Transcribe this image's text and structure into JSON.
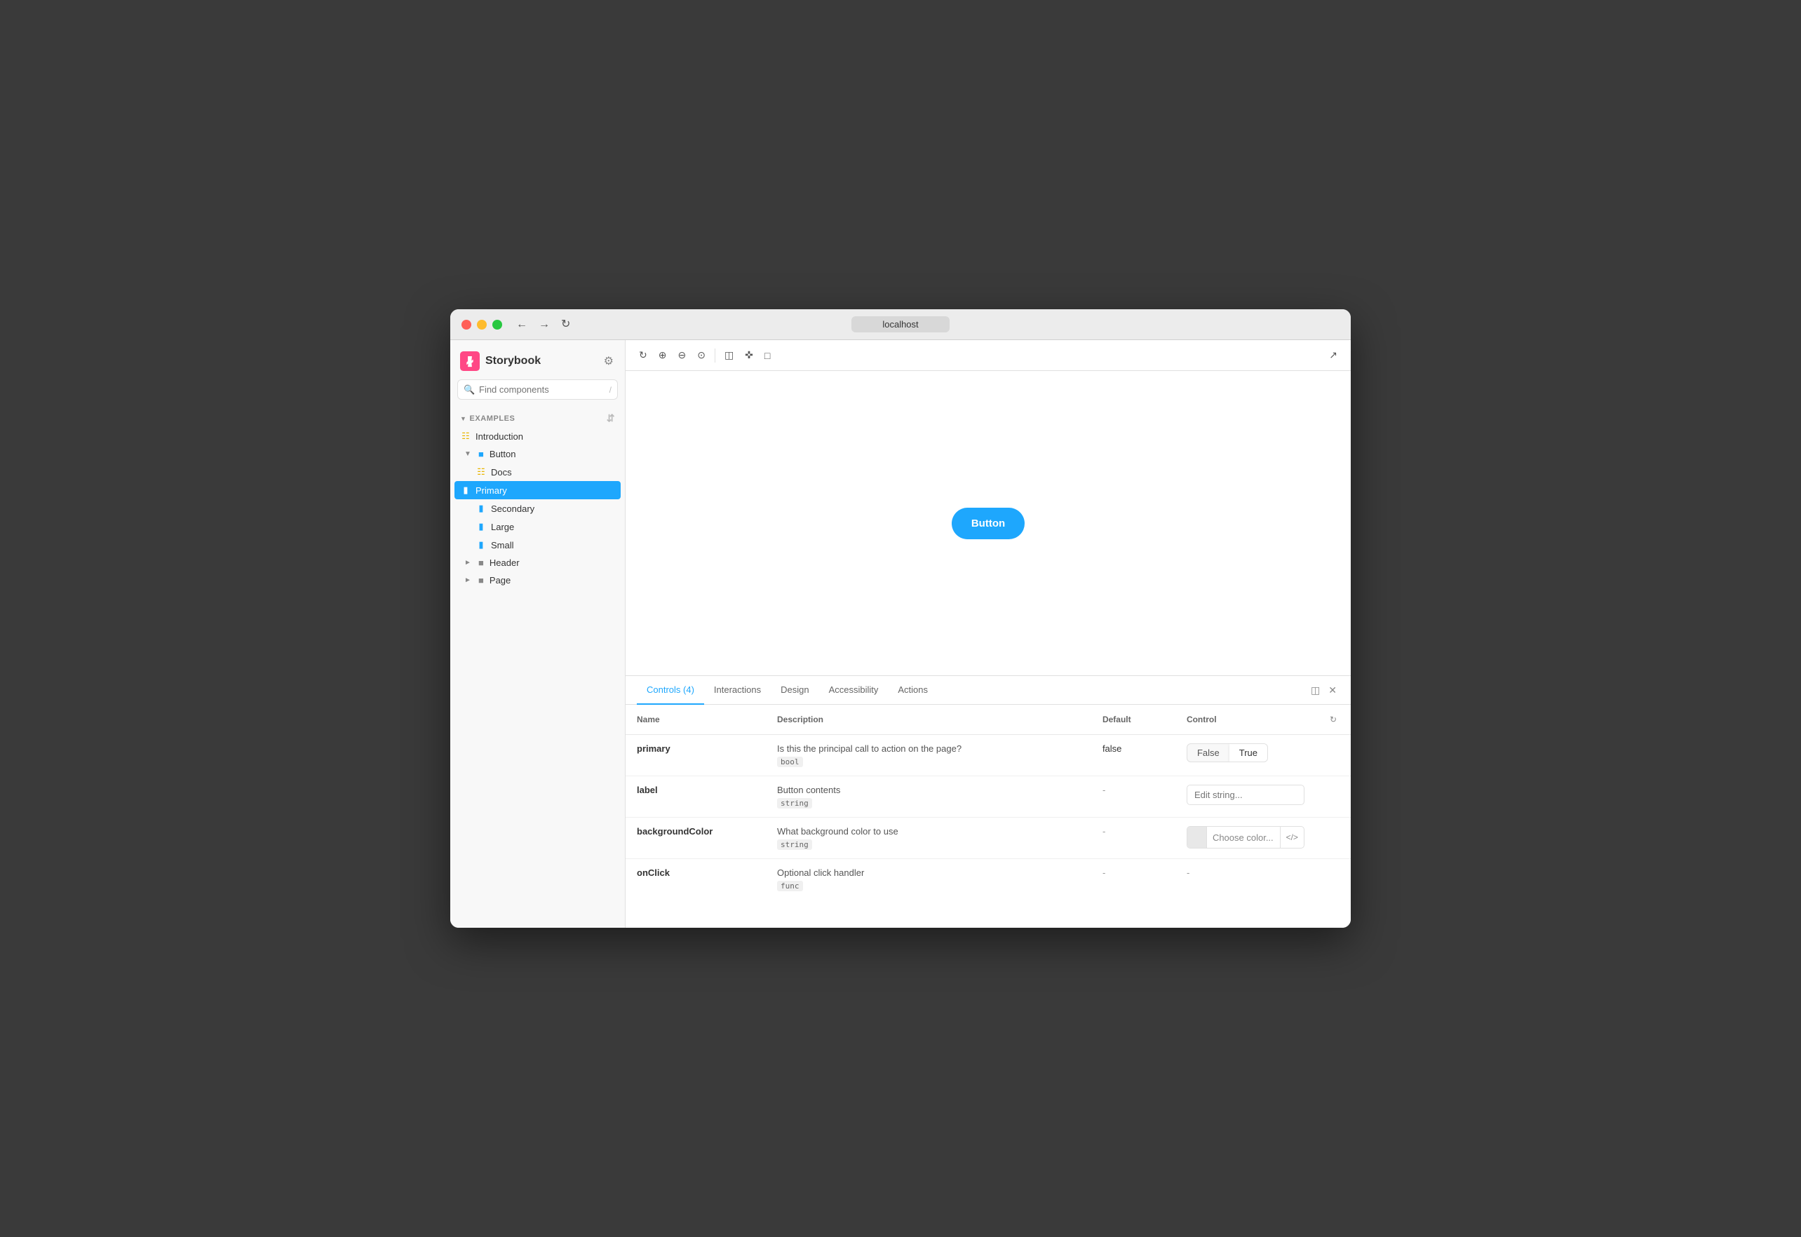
{
  "window": {
    "title": "localhost",
    "traffic_lights": [
      "close",
      "minimize",
      "maximize"
    ]
  },
  "sidebar": {
    "logo_text": "Storybook",
    "search_placeholder": "Find components",
    "search_shortcut": "/",
    "section_label": "EXAMPLES",
    "nav_items": [
      {
        "id": "introduction",
        "label": "Introduction",
        "icon": "docs",
        "depth": 0
      },
      {
        "id": "button",
        "label": "Button",
        "icon": "component",
        "depth": 0,
        "expanded": true
      },
      {
        "id": "button-docs",
        "label": "Docs",
        "icon": "docs",
        "depth": 1
      },
      {
        "id": "button-primary",
        "label": "Primary",
        "icon": "story",
        "depth": 1,
        "active": true
      },
      {
        "id": "button-secondary",
        "label": "Secondary",
        "icon": "story",
        "depth": 1
      },
      {
        "id": "button-large",
        "label": "Large",
        "icon": "story",
        "depth": 1
      },
      {
        "id": "button-small",
        "label": "Small",
        "icon": "story",
        "depth": 1
      },
      {
        "id": "header",
        "label": "Header",
        "icon": "component",
        "depth": 0
      },
      {
        "id": "page",
        "label": "Page",
        "icon": "component",
        "depth": 0
      }
    ]
  },
  "toolbar": {
    "buttons": [
      {
        "id": "reload",
        "symbol": "↺",
        "label": "Reload"
      },
      {
        "id": "zoom-in",
        "symbol": "⊕",
        "label": "Zoom in"
      },
      {
        "id": "zoom-out",
        "symbol": "⊖",
        "label": "Zoom out"
      },
      {
        "id": "zoom-reset",
        "symbol": "⊙",
        "label": "Reset zoom"
      },
      {
        "id": "frame",
        "symbol": "▣",
        "label": "Frame"
      },
      {
        "id": "grid",
        "symbol": "⊞",
        "label": "Grid"
      },
      {
        "id": "measure",
        "symbol": "⊡",
        "label": "Measure"
      },
      {
        "id": "external",
        "symbol": "↗",
        "label": "Open in new tab"
      }
    ]
  },
  "preview": {
    "button_label": "Button"
  },
  "bottom_panel": {
    "tabs": [
      {
        "id": "controls",
        "label": "Controls (4)",
        "active": true
      },
      {
        "id": "interactions",
        "label": "Interactions"
      },
      {
        "id": "design",
        "label": "Design"
      },
      {
        "id": "accessibility",
        "label": "Accessibility"
      },
      {
        "id": "actions",
        "label": "Actions"
      }
    ],
    "table": {
      "headers": {
        "name": "Name",
        "description": "Description",
        "default": "Default",
        "control": "Control"
      },
      "rows": [
        {
          "name": "primary",
          "description": "Is this the principal call to action on the page?",
          "type": "bool",
          "default": "false",
          "control_type": "bool-toggle",
          "false_label": "False",
          "true_label": "True",
          "true_active": true
        },
        {
          "name": "label",
          "description": "Button contents",
          "type": "string",
          "default": "-",
          "control_type": "string-input",
          "placeholder": "Edit string..."
        },
        {
          "name": "backgroundColor",
          "description": "What background color to use",
          "type": "string",
          "default": "-",
          "control_type": "color-picker",
          "color_placeholder": "Choose color..."
        },
        {
          "name": "onClick",
          "description": "Optional click handler",
          "type": "func",
          "default": "-",
          "control_type": "dash"
        }
      ]
    }
  }
}
